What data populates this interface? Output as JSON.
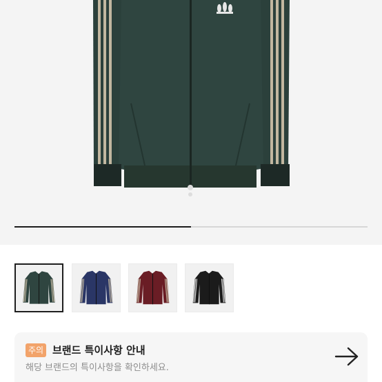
{
  "gallery": {
    "progress_fraction": 0.5,
    "thumbnails": [
      {
        "color": "jacket-green",
        "selected": true
      },
      {
        "color": "jacket-navy",
        "selected": false
      },
      {
        "color": "jacket-burgundy",
        "selected": false
      },
      {
        "color": "jacket-black",
        "selected": false
      }
    ],
    "colors": {
      "green": "#2f4540",
      "navy": "#2a3666",
      "burgundy": "#6a1d25",
      "black": "#1b1b1b",
      "stripe": "#c2b7a0"
    }
  },
  "notice": {
    "badge": "주의",
    "title": "브랜드 특이사항 안내",
    "subtitle": "해당 브랜드의 특이사항을 확인하세요.",
    "badge_color": "#f2a36a",
    "arrow_icon": "arrow-right-icon"
  }
}
